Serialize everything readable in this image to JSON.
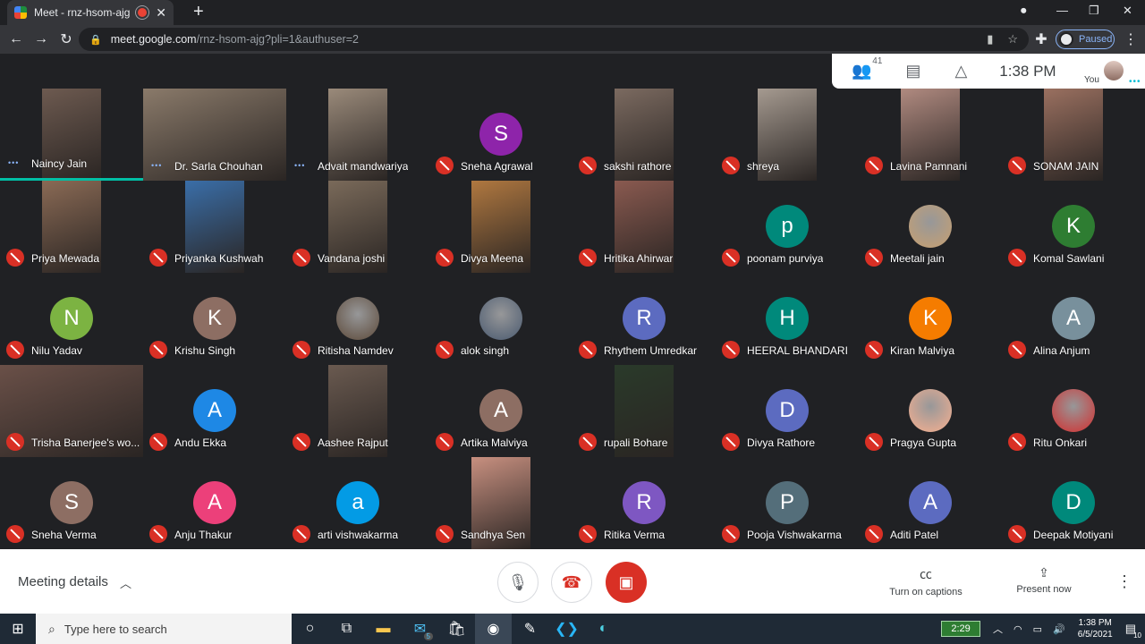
{
  "browser": {
    "tab_title": "Meet - rnz-hsom-ajg",
    "url_host": "meet.google.com",
    "url_path": "/rnz-hsom-ajg?pli=1&authuser=2",
    "profile_status": "Paused"
  },
  "meet": {
    "participant_count": "41",
    "time": "1:38  PM",
    "you_label": "You",
    "meeting_details_label": "Meeting details",
    "captions_label": "Turn on captions",
    "present_label": "Present now"
  },
  "participants": [
    {
      "name": "Naincy Jain",
      "mic": "speaking",
      "avatar": "",
      "color": "#6d5a50"
    },
    {
      "name": "Dr. Sarla Chouhan",
      "mic": "speaking",
      "avatar": "",
      "color": "#8a7a6a"
    },
    {
      "name": "Advait mandwariya",
      "mic": "speaking",
      "avatar": "",
      "color": "#9a8a7a"
    },
    {
      "name": "Sneha Agrawal",
      "mic": "muted",
      "avatar": "S",
      "color": "#8e24aa"
    },
    {
      "name": "sakshi rathore",
      "mic": "muted",
      "avatar": "",
      "color": "#7b6a60"
    },
    {
      "name": "shreya",
      "mic": "muted",
      "avatar": "",
      "color": "#a59a90"
    },
    {
      "name": "Lavina Pamnani",
      "mic": "muted",
      "avatar": "",
      "color": "#b08a80"
    },
    {
      "name": "SONAM JAIN",
      "mic": "muted",
      "avatar": "",
      "color": "#9a7060"
    },
    {
      "name": "Priya Mewada",
      "mic": "muted",
      "avatar": "",
      "color": "#8a6a55"
    },
    {
      "name": "Priyanka Kushwah",
      "mic": "muted",
      "avatar": "",
      "color": "#3a6ea8"
    },
    {
      "name": "Vandana joshi",
      "mic": "muted",
      "avatar": "",
      "color": "#7a6a5a"
    },
    {
      "name": "Divya Meena",
      "mic": "muted",
      "avatar": "",
      "color": "#b07840"
    },
    {
      "name": "Hritika Ahirwar",
      "mic": "muted",
      "avatar": "",
      "color": "#8a5a50"
    },
    {
      "name": "poonam purviya",
      "mic": "muted",
      "avatar": "p",
      "color": "#00897b"
    },
    {
      "name": "Meetali jain",
      "mic": "muted",
      "avatar": "photo",
      "color": "#c8a070"
    },
    {
      "name": "Komal Sawlani",
      "mic": "muted",
      "avatar": "K",
      "color": "#2e7d32"
    },
    {
      "name": "Nilu Yadav",
      "mic": "muted",
      "avatar": "N",
      "color": "#7cb342"
    },
    {
      "name": "Krishu Singh",
      "mic": "muted",
      "avatar": "K",
      "color": "#8d6e63"
    },
    {
      "name": "Ritisha Namdev",
      "mic": "muted",
      "avatar": "photo",
      "color": "#5d4a3a"
    },
    {
      "name": "alok singh",
      "mic": "muted",
      "avatar": "photo",
      "color": "#4a5a70"
    },
    {
      "name": "Rhythem Umredkar",
      "mic": "muted",
      "avatar": "R",
      "color": "#5c6bc0"
    },
    {
      "name": "HEERAL BHANDARI",
      "mic": "muted",
      "avatar": "H",
      "color": "#00897b"
    },
    {
      "name": "Kiran Malviya",
      "mic": "muted",
      "avatar": "K",
      "color": "#f57c00"
    },
    {
      "name": "Alina Anjum",
      "mic": "muted",
      "avatar": "A",
      "color": "#78909c"
    },
    {
      "name": "Trisha Banerjee's wo...",
      "mic": "muted",
      "avatar": "",
      "color": "#6a5048"
    },
    {
      "name": "Andu Ekka",
      "mic": "muted",
      "avatar": "A",
      "color": "#1e88e5"
    },
    {
      "name": "Aashee Rajput",
      "mic": "muted",
      "avatar": "",
      "color": "#6a5a50"
    },
    {
      "name": "Artika Malviya",
      "mic": "muted",
      "avatar": "A",
      "color": "#8d6e63"
    },
    {
      "name": "rupali Bohare",
      "mic": "muted",
      "avatar": "",
      "color": "#2a3a2a"
    },
    {
      "name": "Divya Rathore",
      "mic": "muted",
      "avatar": "D",
      "color": "#5c6bc0"
    },
    {
      "name": "Pragya Gupta",
      "mic": "muted",
      "avatar": "photo",
      "color": "#f8b090"
    },
    {
      "name": "Ritu Onkari",
      "mic": "muted",
      "avatar": "photo",
      "color": "#d32f2f"
    },
    {
      "name": "Sneha Verma",
      "mic": "muted",
      "avatar": "S",
      "color": "#8d6e63"
    },
    {
      "name": "Anju Thakur",
      "mic": "muted",
      "avatar": "A",
      "color": "#ec407a"
    },
    {
      "name": "arti vishwakarma",
      "mic": "muted",
      "avatar": "a",
      "color": "#039be5"
    },
    {
      "name": "Sandhya Sen",
      "mic": "muted",
      "avatar": "",
      "color": "#c89080"
    },
    {
      "name": "Ritika Verma",
      "mic": "muted",
      "avatar": "R",
      "color": "#7e57c2"
    },
    {
      "name": "Pooja Vishwakarma",
      "mic": "muted",
      "avatar": "P",
      "color": "#546e7a"
    },
    {
      "name": "Aditi Patel",
      "mic": "muted",
      "avatar": "A",
      "color": "#5c6bc0"
    },
    {
      "name": "Deepak Motiyani",
      "mic": "muted",
      "avatar": "D",
      "color": "#00897b"
    }
  ],
  "taskbar": {
    "search_placeholder": "Type here to search",
    "mail_badge": "5",
    "battery": "2:29",
    "time": "1:38 PM",
    "date": "6/5/2021",
    "notif_count": "10"
  }
}
